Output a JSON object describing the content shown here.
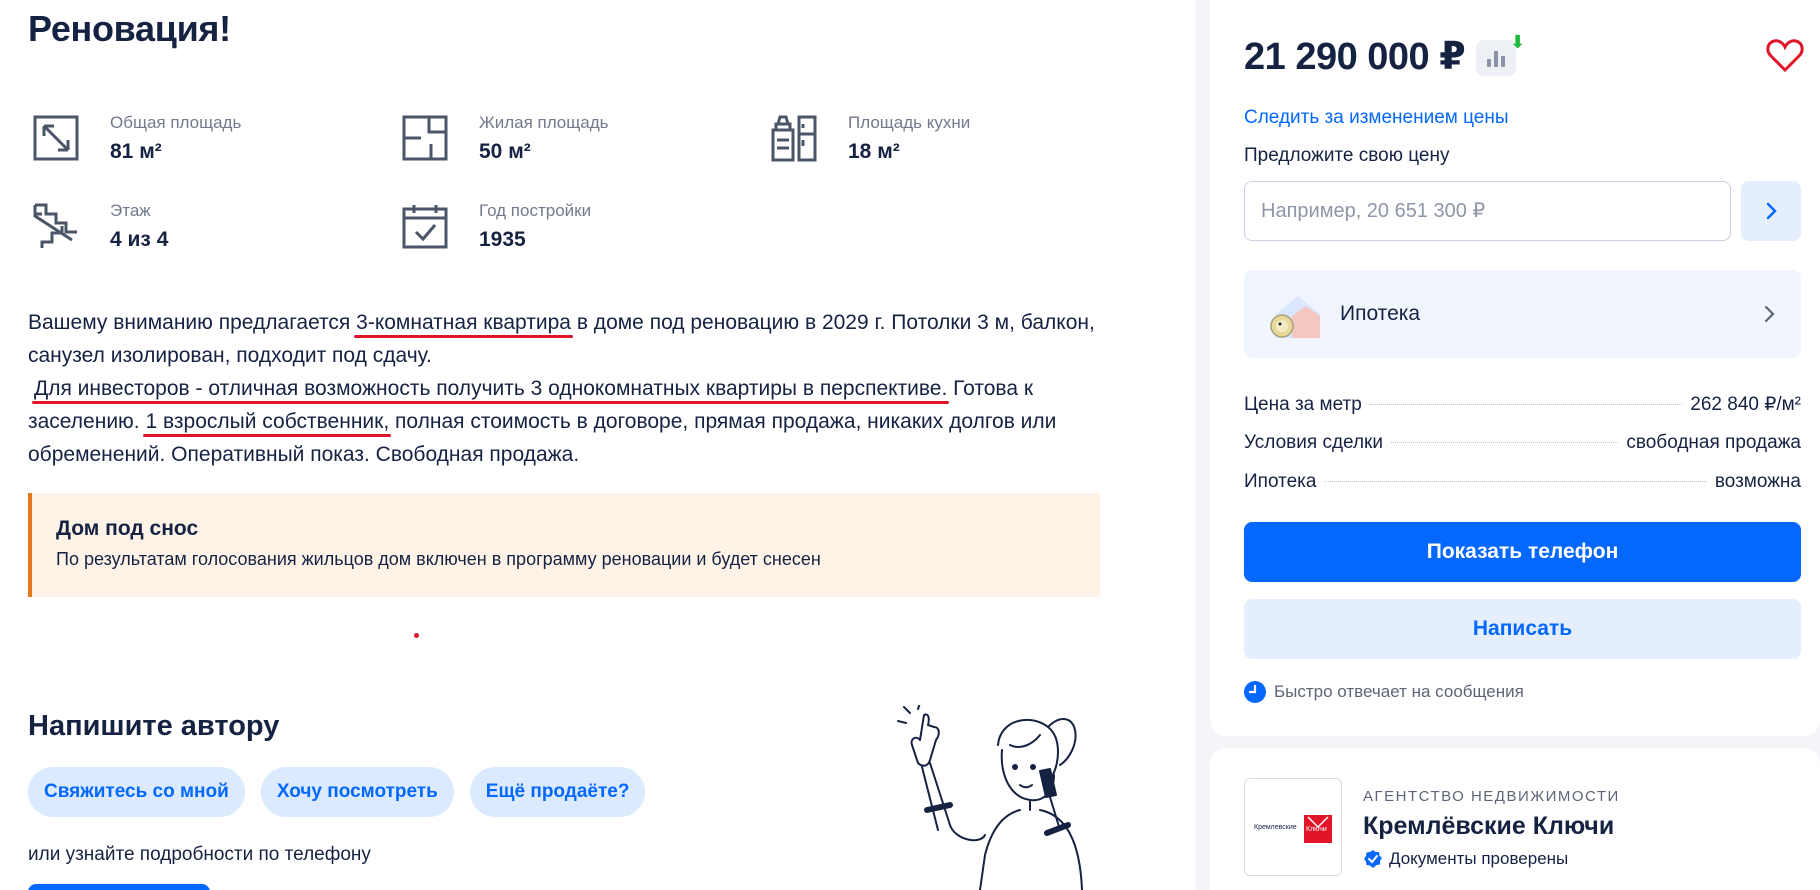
{
  "listing": {
    "title": "Реновация!",
    "features": [
      {
        "icon": "total-area-icon",
        "label": "Общая площадь",
        "value": "81 м²"
      },
      {
        "icon": "living-area-icon",
        "label": "Жилая площадь",
        "value": "50 м²"
      },
      {
        "icon": "kitchen-area-icon",
        "label": "Площадь кухни",
        "value": "18 м²"
      },
      {
        "icon": "floor-stairs-icon",
        "label": "Этаж",
        "value": "4 из 4"
      },
      {
        "icon": "calendar-icon",
        "label": "Год постройки",
        "value": "1935"
      }
    ],
    "description": {
      "p1_a": "Вашему вниманию предлагается ",
      "p1_ul": "3-комнатная квартира",
      "p1_b": " в доме под реновацию в 2029 г. Потолки 3 м, балкон, санузел изолирован, подходит под сдачу.",
      "p2_ul": "Для инвесторов - отличная возможность получить 3 однокомнатных квартиры в перспективе.",
      "p2_a": " Готова к заселению. ",
      "p2_ul2": "1 взрослый собственник,",
      "p2_b": " полная стоимость в договоре, прямая продажа, никаких долгов или обременений. Оперативный показ.  Свободная продажа."
    },
    "notice": {
      "heading": "Дом под снос",
      "text": "По результатам голосования жильцов дом включен в программу реновации и будет снесен",
      "accent_color": "#e5771d"
    }
  },
  "contact_author": {
    "heading": "Напишите автору",
    "chips": [
      "Свяжитесь со мной",
      "Хочу посмотреть",
      "Ещё продаёте?"
    ],
    "phone_hint": "или узнайте подробности по телефону"
  },
  "sidebar": {
    "price": "21 290 000 ₽",
    "track_price": "Следить за изменением цены",
    "offer_label": "Предложите свою цену",
    "offer_placeholder": "Например, 20 651 300 ₽",
    "mortgage_label": "Ипотека",
    "details": [
      {
        "key": "Цена за метр",
        "value": "262 840 ₽/м²"
      },
      {
        "key": "Условия сделки",
        "value": "свободная продажа"
      },
      {
        "key": "Ипотека",
        "value": "возможна"
      }
    ],
    "show_phone": "Показать телефон",
    "write": "Написать",
    "fast_reply": "Быстро отвечает на сообщения",
    "brand_color": "#0468ff"
  },
  "agency": {
    "kind": "АГЕНТСТВО НЕДВИЖИМОСТИ",
    "name": "Кремлёвские Ключи",
    "verified": "Документы проверены",
    "logo_text_left": "Кремлевские",
    "logo_text_right": "Ключи"
  }
}
